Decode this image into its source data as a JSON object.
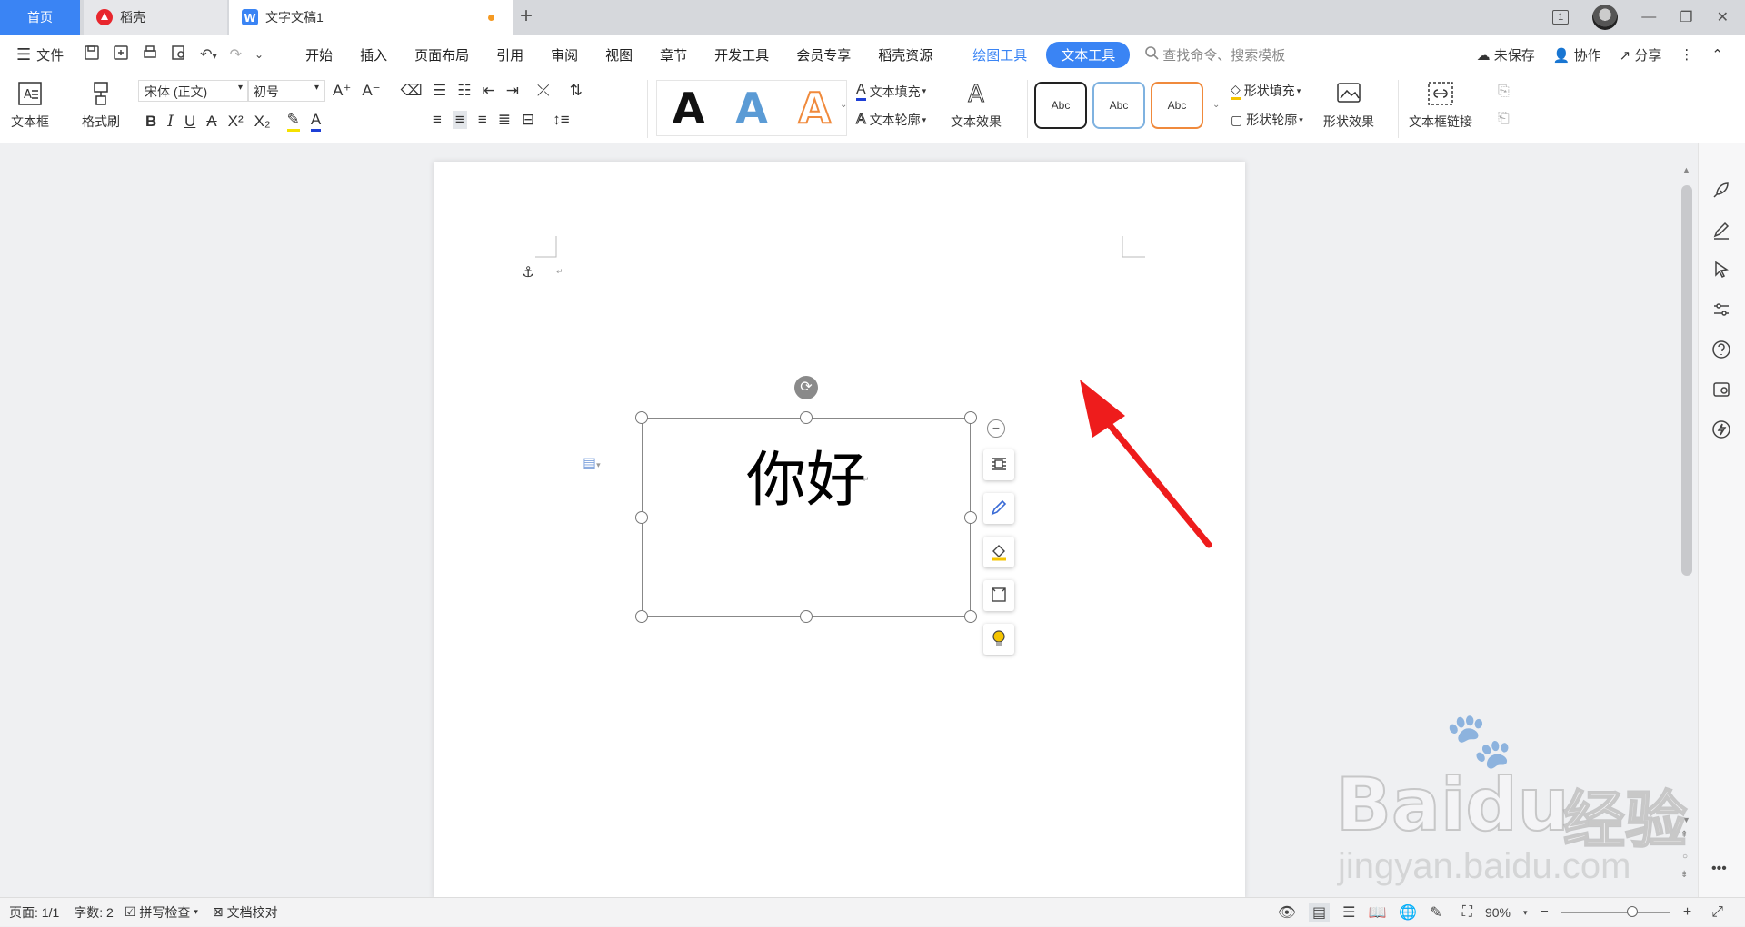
{
  "tabs": {
    "home": "首页",
    "daoke": "稻壳",
    "doc": "文字文稿1",
    "page_badge": "1"
  },
  "menu": {
    "file": "文件",
    "items": [
      "开始",
      "插入",
      "页面布局",
      "引用",
      "审阅",
      "视图",
      "章节",
      "开发工具",
      "会员专享",
      "稻壳资源"
    ],
    "drawing_tools": "绘图工具",
    "text_tools": "文本工具",
    "search": "查找命令、搜索模板",
    "unsaved": "未保存",
    "collab": "协作",
    "share": "分享"
  },
  "ribbon": {
    "textbox": "文本框",
    "format_painter": "格式刷",
    "font_name": "宋体 (正文)",
    "font_size": "初号",
    "art_letter": "A",
    "text_fill": "文本填充",
    "text_outline": "文本轮廓",
    "text_effect": "文本效果",
    "shape_style": "Abc",
    "shape_fill": "形状填充",
    "shape_outline": "形状轮廓",
    "shape_effect": "形状效果",
    "textbox_link": "文本框链接"
  },
  "document": {
    "textbox_text": "你好"
  },
  "status": {
    "page": "页面: 1/1",
    "words": "字数: 2",
    "spell": "拼写检查",
    "proof": "文档校对",
    "zoom": "90%"
  },
  "watermark": {
    "brand": "Baidu",
    "cn": "经验",
    "url": "jingyan.baidu.com"
  },
  "colors": {
    "accent": "#3a84f4",
    "arrow": "#ee1c1c",
    "shape_orange": "#f08a3c"
  }
}
